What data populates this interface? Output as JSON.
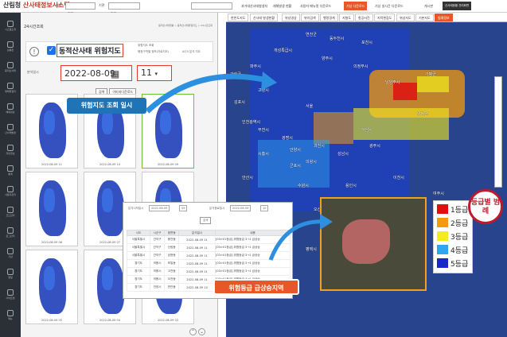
{
  "brand": {
    "org": "산림청",
    "sys": "산사태정보시스템"
  },
  "topbar": {
    "region1": "전국",
    "region2": "전국",
    "region_label": "지역",
    "unit": "기관",
    "menus": [
      "과거대산사태발생지",
      "재해발생 현황",
      "사용자 매뉴얼 다운로드",
      "기상 다운로드",
      "기상 실시간 다운로드",
      "게시판",
      "산사태현황 관리화면"
    ]
  },
  "nav": [
    "시스템소개",
    "상황판",
    "동적산사태",
    "재해위험지",
    "예측정보",
    "산사태발생",
    "지반정보",
    "통계",
    "사용자관리",
    "코드관리",
    "로그관리",
    "기상",
    "알림",
    "사이트맵",
    "메뉴"
  ],
  "panel": {
    "title": "24시간조회",
    "breadcrumb": "동적산사태현황 > 동적산사태위험지도 > 24시간조회",
    "checkbox_label": "동적산사태 위험지도",
    "small1": "위험지도 조회",
    "small2": "행정구역별 정보(자료지도)",
    "small3": "AI15 분석 지도",
    "date_label": "분석일시",
    "date_value": "2022-08-09",
    "hour_value": "11",
    "btn_search": "검색",
    "btn_download": "이미지다운로드",
    "maps": [
      {
        "cap": "2022-08-09 11"
      },
      {
        "cap": "2022-08-09 10"
      },
      {
        "cap": "2022-08-09 09"
      },
      {
        "cap": "2022-08-09 08"
      },
      {
        "cap": "2022-08-09 07"
      },
      {
        "cap": "2022-08-09 06"
      },
      {
        "cap": "2022-08-09 05"
      },
      {
        "cap": "2022-08-09 04"
      },
      {
        "cap": "2022-08-09 03"
      }
    ]
  },
  "callout_blue": "위험지도 조회 일시",
  "callout_orange": "위험등급 급상승지역",
  "map": {
    "buttons": [
      "한반도지도",
      "산사태 발생현황",
      "위성영상",
      "위치검색",
      "행정경계",
      "지형도",
      "항공사진",
      "지적편집도",
      "위성지도",
      "기본지도",
      "범례정보"
    ],
    "cities": [
      "개성특급시",
      "양주시",
      "의정부시",
      "남양주시",
      "서울",
      "인천광역시",
      "부천시",
      "광명시",
      "시흥시",
      "안양시",
      "과천시",
      "성남시",
      "하남시",
      "안산시",
      "군포시",
      "의왕시",
      "수원시",
      "용인시",
      "화성시",
      "오산시",
      "평택시",
      "안성시",
      "이천시",
      "여주시",
      "광주시",
      "양평군",
      "가평군",
      "포천시",
      "동두천시",
      "연천군",
      "고양시",
      "파주시",
      "김포시",
      "강화군"
    ]
  },
  "legend": {
    "title": "등급별 범례",
    "items": [
      {
        "label": "1등급",
        "color": "#e11010"
      },
      {
        "label": "2등급",
        "color": "#f39a0e"
      },
      {
        "label": "3등급",
        "color": "#f3ec1c"
      },
      {
        "label": "4등급",
        "color": "#2fa7ef"
      },
      {
        "label": "5등급",
        "color": "#1626c8"
      }
    ]
  },
  "table": {
    "label_from": "분석시작일시",
    "from": "2022-08-09",
    "from_h": "09",
    "label_to": "분석종료일시",
    "to": "2022-08-09",
    "to_h": "10",
    "btn": "검색",
    "headers": [
      "시도",
      "시군구",
      "읍면동",
      "분석일시",
      "내용"
    ],
    "rows": [
      [
        "서울특별시",
        "관악구",
        "봉천동",
        "2022-08-09 11",
        "[03>01등급] 위험등급 3→1 급상승"
      ],
      [
        "서울특별시",
        "관악구",
        "신림동",
        "2022-08-09 11",
        "[03>01등급] 위험등급 3→1 급상승"
      ],
      [
        "서울특별시",
        "관악구",
        "남현동",
        "2022-08-09 11",
        "[03>01등급] 위험등급 3→1 급상승"
      ],
      [
        "경기도",
        "의왕시",
        "포일동",
        "2022-08-09 11",
        "[03>01등급] 위험등급 3→1 급상승"
      ],
      [
        "경기도",
        "의왕시",
        "고천동",
        "2022-08-09 11",
        "[03>01등급] 위험등급 3→1 급상승"
      ],
      [
        "경기도",
        "의왕시",
        "오전동",
        "2022-08-09 11",
        "[03>01등급] 위험등급 3→1 급상승"
      ],
      [
        "경기도",
        "안양시",
        "만안동",
        "2022-08-09 10",
        "[03>01등급] 위험등급 3→1 급상승"
      ]
    ]
  }
}
